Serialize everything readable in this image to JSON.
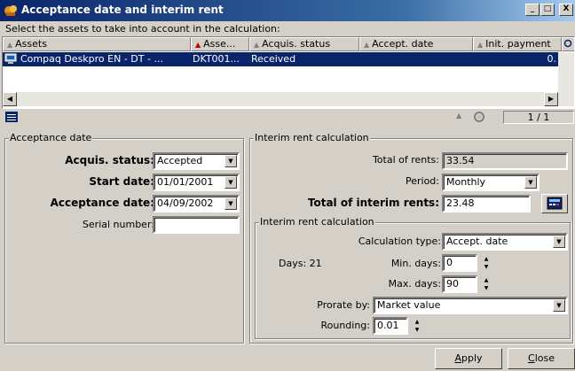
{
  "window": {
    "title": "Acceptance date and interim rent",
    "minimize": "_",
    "maximize": "□",
    "close": "X"
  },
  "instruction": "Select the assets to take into account in the calculation:",
  "list": {
    "columns": [
      {
        "label": "Assets"
      },
      {
        "label": "Asse..."
      },
      {
        "label": "Acquis. status"
      },
      {
        "label": "Accept. date"
      },
      {
        "label": "Init. payment"
      }
    ],
    "rows": [
      {
        "asset": "Compaq Deskpro EN - DT - ...",
        "asset_tag": "DKT001...",
        "acquis_status": "Received",
        "accept_date": "",
        "init_payment": "0."
      }
    ],
    "count": "1 / 1"
  },
  "acceptance": {
    "legend": "Acceptance date",
    "acquis_status_label": "Acquis. status:",
    "acquis_status_value": "Accepted",
    "start_date_label": "Start date:",
    "start_date_value": "01/01/2001",
    "acceptance_date_label": "Acceptance date:",
    "acceptance_date_value": "04/09/2002",
    "serial_label": "Serial number:",
    "serial_value": ""
  },
  "interim": {
    "legend": "Interim rent calculation",
    "total_rents_label": "Total of rents:",
    "total_rents_value": "33.54",
    "period_label": "Period:",
    "period_value": "Monthly",
    "total_interim_label": "Total of interim rents:",
    "total_interim_value": "23.48",
    "sub": {
      "legend": "Interim rent calculation",
      "calc_type_label": "Calculation type:",
      "calc_type_value": "Accept. date",
      "days_text": "Days: 21",
      "min_days_label": "Min. days:",
      "min_days_value": "0",
      "max_days_label": "Max. days:",
      "max_days_value": "90",
      "prorate_label": "Prorate by:",
      "prorate_value": "Market value",
      "rounding_label": "Rounding:",
      "rounding_value": "0.01"
    }
  },
  "buttons": {
    "apply_first": "A",
    "apply_rest": "pply",
    "close_first": "C",
    "close_rest": "lose"
  }
}
